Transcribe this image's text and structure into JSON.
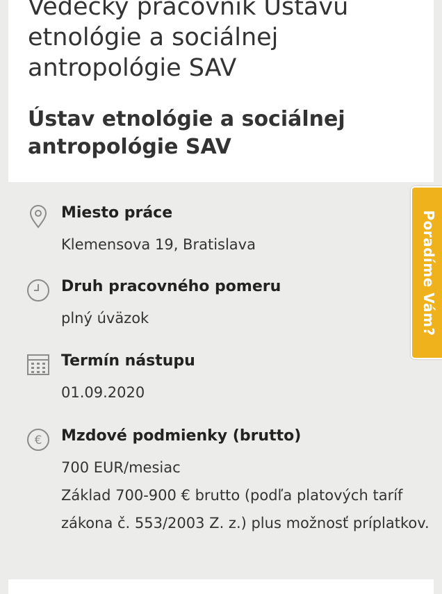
{
  "header": {
    "job_title": "Vedecký pracovník Ústavu etnológie a sociálnej antropológie SAV",
    "company": "Ústav etnológie a sociálnej antropológie SAV"
  },
  "details": {
    "location": {
      "label": "Miesto práce",
      "value": "Klemensova 19, Bratislava",
      "icon": "map-pin-icon"
    },
    "contract": {
      "label": "Druh pracovného pomeru",
      "value": "plný úväzok",
      "icon": "clock-icon"
    },
    "start": {
      "label": "Termín nástupu",
      "value": "01.09.2020",
      "icon": "calendar-icon"
    },
    "salary": {
      "label": "Mzdové podmienky (brutto)",
      "value": "700 EUR/mesiac",
      "note": "Základ 700-900 € brutto (podľa platových taríf zákona č. 553/2003 Z. z.) plus možnosť príplatkov.",
      "icon": "euro-icon"
    }
  },
  "advice_tab": {
    "label": "Poradíme Vám?",
    "color": "#f0b21c"
  }
}
